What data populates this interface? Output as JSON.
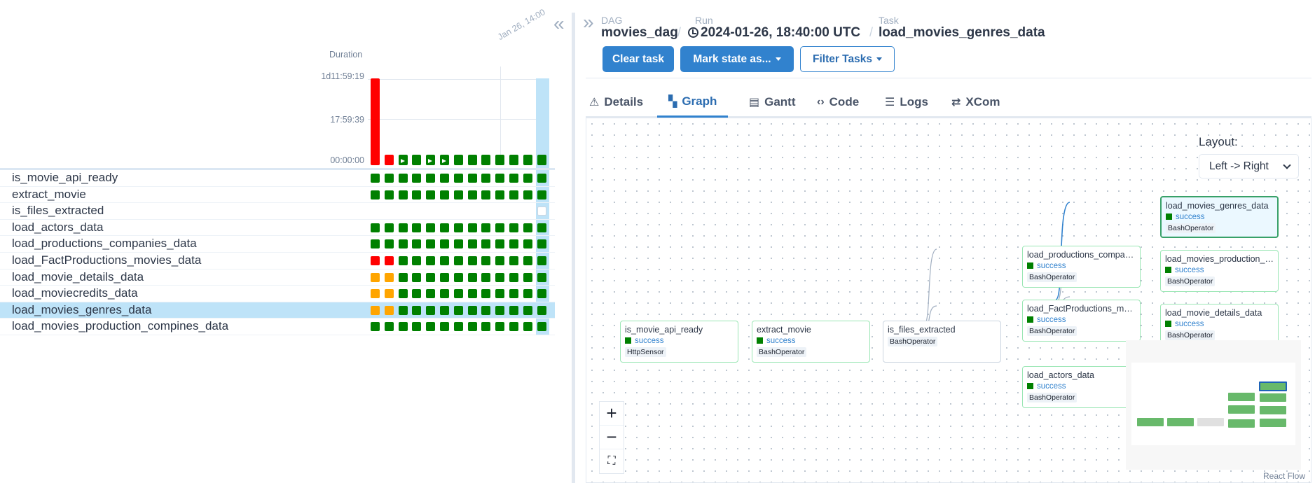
{
  "grid": {
    "duration_label": "Duration",
    "y_ticks": [
      "1d11:59:19",
      "17:59:39",
      "00:00:00"
    ],
    "date_label": "Jan 26, 14:00",
    "collapse_icon": "«",
    "runs": [
      {
        "color": "#ff0000",
        "duration_frac": 1.0,
        "play": false
      },
      {
        "color": "#ff0000",
        "duration_frac": 0.09,
        "play": false
      },
      {
        "color": "#008000",
        "duration_frac": 0.09,
        "play": true
      },
      {
        "color": "#008000",
        "duration_frac": 0.09,
        "play": false
      },
      {
        "color": "#008000",
        "duration_frac": 0.09,
        "play": true
      },
      {
        "color": "#008000",
        "duration_frac": 0.09,
        "play": true
      },
      {
        "color": "#008000",
        "duration_frac": 0.09,
        "play": false
      },
      {
        "color": "#008000",
        "duration_frac": 0.09,
        "play": false
      },
      {
        "color": "#008000",
        "duration_frac": 0.09,
        "play": false
      },
      {
        "color": "#008000",
        "duration_frac": 0.09,
        "play": false
      },
      {
        "color": "#008000",
        "duration_frac": 0.09,
        "play": false
      },
      {
        "color": "#008000",
        "duration_frac": 0.09,
        "play": false
      },
      {
        "color": "#008000",
        "duration_frac": 0.09,
        "play": false
      }
    ],
    "tasks": [
      {
        "name": "is_movie_api_ready",
        "states": [
          "g",
          "g",
          "g",
          "g",
          "g",
          "g",
          "g",
          "g",
          "g",
          "g",
          "g",
          "g",
          "g"
        ]
      },
      {
        "name": "extract_movie",
        "states": [
          "g",
          "g",
          "g",
          "g",
          "g",
          "g",
          "g",
          "g",
          "g",
          "g",
          "g",
          "g",
          "g"
        ]
      },
      {
        "name": "is_files_extracted",
        "states": [
          "",
          "",
          "",
          "",
          "",
          "",
          "",
          "",
          "",
          "",
          "",
          "",
          "e"
        ]
      },
      {
        "name": "load_actors_data",
        "states": [
          "g",
          "g",
          "g",
          "g",
          "g",
          "g",
          "g",
          "g",
          "g",
          "g",
          "g",
          "g",
          "g"
        ]
      },
      {
        "name": "load_productions_companies_data",
        "states": [
          "g",
          "g",
          "g",
          "g",
          "g",
          "g",
          "g",
          "g",
          "g",
          "g",
          "g",
          "g",
          "g"
        ]
      },
      {
        "name": "load_FactProductions_movies_data",
        "states": [
          "r",
          "r",
          "g",
          "g",
          "g",
          "g",
          "g",
          "g",
          "g",
          "g",
          "g",
          "g",
          "g"
        ]
      },
      {
        "name": "load_movie_details_data",
        "states": [
          "o",
          "o",
          "g",
          "g",
          "g",
          "g",
          "g",
          "g",
          "g",
          "g",
          "g",
          "g",
          "g"
        ]
      },
      {
        "name": "load_moviecredits_data",
        "states": [
          "o",
          "o",
          "g",
          "g",
          "g",
          "g",
          "g",
          "g",
          "g",
          "g",
          "g",
          "g",
          "g"
        ]
      },
      {
        "name": "load_movies_genres_data",
        "states": [
          "o",
          "o",
          "g",
          "g",
          "g",
          "g",
          "g",
          "g",
          "g",
          "g",
          "g",
          "g",
          "g"
        ],
        "selected": true
      },
      {
        "name": "load_movies_production_compines_data",
        "states": [
          "g",
          "g",
          "g",
          "g",
          "g",
          "g",
          "g",
          "g",
          "g",
          "g",
          "g",
          "g",
          "g"
        ]
      }
    ],
    "state_colors": {
      "g": "#008000",
      "r": "#ff0000",
      "o": "#ffa500"
    }
  },
  "details": {
    "expand_icon": "»",
    "breadcrumb": {
      "dag_key": "DAG",
      "dag": "movies_dag",
      "run_key": "Run",
      "run": "2024-01-26, 18:40:00 UTC",
      "task_key": "Task",
      "task": "load_movies_genres_data",
      "sep": "/"
    },
    "buttons": {
      "clear": "Clear task",
      "mark": "Mark state as...",
      "filter": "Filter Tasks"
    },
    "tabs": [
      {
        "label": "Details",
        "icon": "⚠"
      },
      {
        "label": "Graph",
        "icon": "▚"
      },
      {
        "label": "Gantt",
        "icon": "▤"
      },
      {
        "label": "Code",
        "icon": "‹›"
      },
      {
        "label": "Logs",
        "icon": "☰"
      },
      {
        "label": "XCom",
        "icon": "⇄"
      }
    ],
    "active_tab": "Graph",
    "graph": {
      "layout_label": "Layout:",
      "layout_value": "Left -> Right",
      "nodes": [
        {
          "name": "is_movie_api_ready",
          "status": "success",
          "operator": "HttpSensor"
        },
        {
          "name": "extract_movie",
          "status": "success",
          "operator": "BashOperator"
        },
        {
          "name": "is_files_extracted",
          "status": "",
          "operator": "BashOperator"
        },
        {
          "name": "load_productions_compani...",
          "status": "success",
          "operator": "BashOperator"
        },
        {
          "name": "load_FactProductions_movi...",
          "status": "success",
          "operator": "BashOperator"
        },
        {
          "name": "load_actors_data",
          "status": "success",
          "operator": "BashOperator"
        },
        {
          "name": "load_movies_genres_data",
          "status": "success",
          "operator": "BashOperator",
          "selected": true
        },
        {
          "name": "load_movies_production_c...",
          "status": "success",
          "operator": "BashOperator"
        },
        {
          "name": "load_movie_details_data",
          "status": "success",
          "operator": "BashOperator"
        }
      ],
      "zoom": {
        "in": "+",
        "out": "−",
        "fit": "⛶"
      },
      "attribution": "React Flow"
    }
  }
}
